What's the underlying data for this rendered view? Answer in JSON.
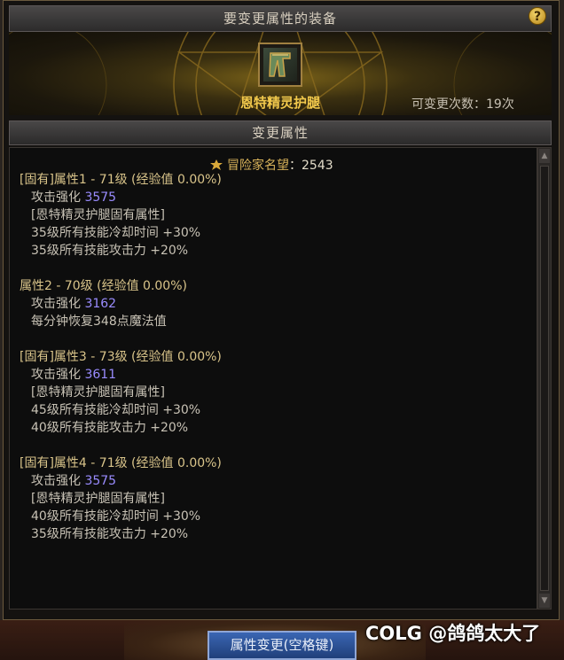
{
  "header": {
    "title": "要变更属性的装备",
    "help_icon_glyph": "?"
  },
  "equipment": {
    "name": "恩特精灵护腿",
    "change_count": "可变更次数：19次"
  },
  "section": {
    "title": "变更属性"
  },
  "fame": {
    "label": "冒险家名望",
    "value": "：2543"
  },
  "attributes": [
    {
      "header": "[固有]属性1 - 71级 (经验值 0.00%)",
      "stat_label": "攻击强化",
      "stat_value": "3575",
      "desc": "[恩特精灵护腿固有属性]",
      "lines": [
        "35级所有技能冷却时间 +30%",
        "35级所有技能攻击力 +20%"
      ]
    },
    {
      "header": "属性2 - 70级 (经验值 0.00%)",
      "stat_label": "攻击强化",
      "stat_value": "3162",
      "desc": "",
      "lines": [
        "每分钟恢复348点魔法值"
      ]
    },
    {
      "header": "[固有]属性3 - 73级 (经验值 0.00%)",
      "stat_label": "攻击强化",
      "stat_value": "3611",
      "desc": "[恩特精灵护腿固有属性]",
      "lines": [
        "45级所有技能冷却时间 +30%",
        "40级所有技能攻击力 +20%"
      ]
    },
    {
      "header": "[固有]属性4 - 71级 (经验值 0.00%)",
      "stat_label": "攻击强化",
      "stat_value": "3575",
      "desc": "[恩特精灵护腿固有属性]",
      "lines": [
        "40级所有技能冷却时间 +30%",
        "35级所有技能攻击力 +20%"
      ]
    }
  ],
  "footer": {
    "confirm_label": "属性变更(空格键)"
  },
  "watermark": {
    "text": "COLG @鸽鸽太大了"
  },
  "scrollbar": {
    "up_glyph": "▲",
    "down_glyph": "▼"
  },
  "colors": {
    "item_name": "#f2c94c",
    "stat_value": "#9a8cff",
    "button": "#2f56a0"
  }
}
